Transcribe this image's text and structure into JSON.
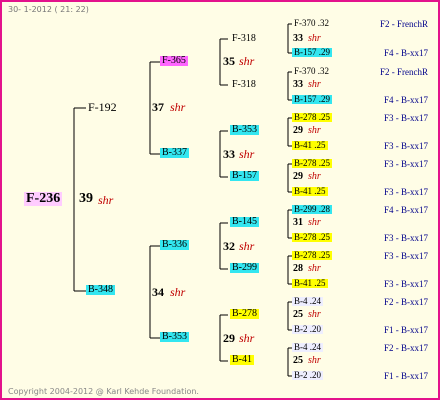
{
  "header": {
    "date": "30-  1-2012 ( 21: 22)"
  },
  "footer": {
    "copyright": "Copyright 2004-2012 @ Karl Kehde Foundation."
  },
  "root": {
    "id": "F-236",
    "gen": "39",
    "shr": "shr"
  },
  "gen1": [
    {
      "id": "F-192",
      "gen": "37",
      "shr": "shr"
    },
    {
      "id": "B-348",
      "gen": "34",
      "shr": "shr"
    }
  ],
  "gen2": [
    {
      "id": "F-365",
      "gen": "35",
      "shr": "shr"
    },
    {
      "id": "B-337",
      "gen": "33",
      "shr": "shr"
    },
    {
      "id": "B-336",
      "gen": "32",
      "shr": "shr"
    },
    {
      "id": "B-353",
      "gen": "29",
      "shr": "shr"
    }
  ],
  "gen3": [
    {
      "id": "F-318",
      "gen": "33",
      "shr": "shr"
    },
    {
      "id": "F-318",
      "gen": "33",
      "shr": "shr"
    },
    {
      "id": "B-353",
      "gen": "29",
      "shr": "shr"
    },
    {
      "id": "B-157",
      "gen": "29",
      "shr": "shr"
    },
    {
      "id": "B-145",
      "gen": "31",
      "shr": "shr"
    },
    {
      "id": "B-299",
      "gen": "28",
      "shr": "shr"
    },
    {
      "id": "B-278",
      "gen": "25",
      "shr": "shr"
    },
    {
      "id": "B-41",
      "gen": "25",
      "shr": "shr"
    }
  ],
  "gen4": [
    {
      "id": "F-370",
      "val": ".32"
    },
    {
      "id": "B-157",
      "val": ".29"
    },
    {
      "id": "F-370",
      "val": ".32"
    },
    {
      "id": "B-157",
      "val": ".29"
    },
    {
      "id": "B-278",
      "val": ".25"
    },
    {
      "id": "B-41",
      "val": ".25"
    },
    {
      "id": "B-278",
      "val": ".25"
    },
    {
      "id": "B-41",
      "val": ".25"
    },
    {
      "id": "B-299",
      "val": ".28"
    },
    {
      "id": "B-278",
      "val": ".25"
    },
    {
      "id": "B-278",
      "val": ".25"
    },
    {
      "id": "B-41",
      "val": ".25"
    },
    {
      "id": "B-4",
      "val": ".24"
    },
    {
      "id": "B-2",
      "val": ".20"
    },
    {
      "id": "B-4",
      "val": ".24"
    },
    {
      "id": "B-2",
      "val": ".20"
    }
  ],
  "right_labels": [
    "F2 - FrenchR",
    "F4 - B-xx17",
    "F2 - FrenchR",
    "F4 - B-xx17",
    "F3 - B-xx17",
    "F3 - B-xx17",
    "F3 - B-xx17",
    "F3 - B-xx17",
    "F4 - B-xx17",
    "F3 - B-xx17",
    "F3 - B-xx17",
    "F3 - B-xx17",
    "F2 - B-xx17",
    "F1 - B-xx17",
    "F2 - B-xx17",
    "F1 - B-xx17"
  ]
}
